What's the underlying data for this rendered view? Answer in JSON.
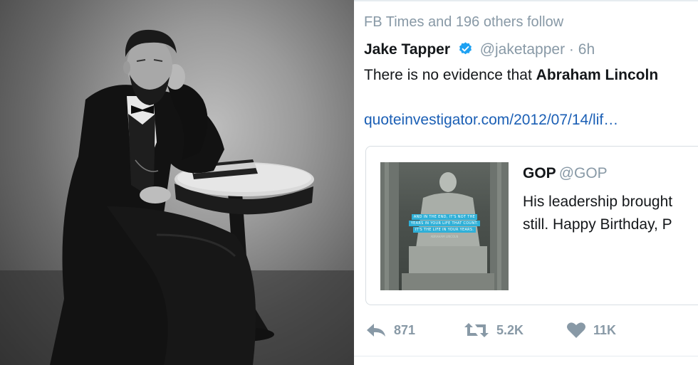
{
  "tweet": {
    "social_context": "FB Times and 196 others follow",
    "author_name": "Jake Tapper",
    "author_handle": "@jaketapper",
    "time_sep": " · ",
    "time": "6h",
    "text_prefix": "There is no evidence that ",
    "text_bold": "Abraham Lincoln",
    "link": "quoteinvestigator.com/2012/07/14/lif…",
    "quoted": {
      "author_name": "GOP",
      "author_handle": "@GOP",
      "text_line1": "His leadership brought",
      "text_line2": "still. Happy Birthday, P",
      "image_caption_lines": [
        "AND IN THE END, IT'S NOT THE",
        "YEARS IN YOUR LIFE THAT COUNT.",
        "IT'S THE LIFE IN YOUR YEARS."
      ],
      "image_attribution": "ABRAHAM LINCOLN"
    },
    "actions": {
      "reply_count": "871",
      "retweet_count": "5.2K",
      "like_count": "11K"
    }
  },
  "colors": {
    "muted": "#8899a6",
    "link": "#1b5fb5",
    "verified": "#1da1f2",
    "caption_bg": "#2fb0d8"
  },
  "icons": [
    "verified-badge-icon",
    "reply-icon",
    "retweet-icon",
    "like-icon"
  ]
}
